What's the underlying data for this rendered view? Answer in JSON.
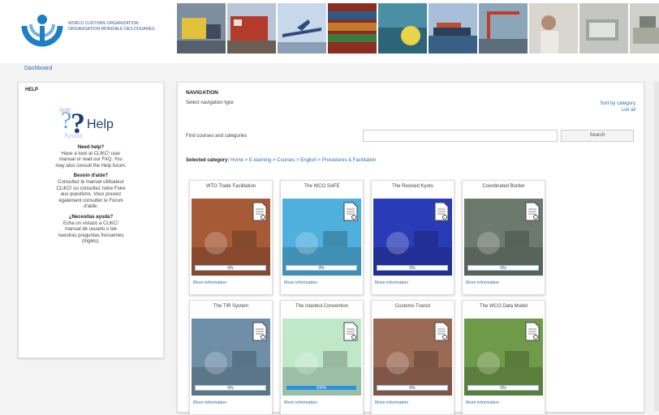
{
  "header": {
    "logo_text_line1": "WORLD CUSTOMS ORGANIZATION",
    "logo_text_line2": "ORGANISATION MONDIALE DES DOUANES",
    "banner_images": [
      "truck-photo",
      "train-photo",
      "airplane-photo",
      "containers-photo",
      "port-worker-photo",
      "cargo-ship-photo",
      "crane-photo",
      "inspector-photo",
      "office-photo",
      "desk-photo"
    ]
  },
  "dashboard_link": "Dashboard",
  "help": {
    "title": "HELP",
    "graphic_word": "Help",
    "sections": [
      {
        "heading": "Need help?",
        "text": "Have a look at CLIKC! user manual or read our FAQ. You may also consult the Help forum."
      },
      {
        "heading": "Besoin d'aide?",
        "text": "Consultez le manuel utilisateur CLiKC! ou consultez notre Foire aux questions. Vous pouvez également consulter le Forum d'aide."
      },
      {
        "heading": "¿Necesitas ayuda?",
        "text": "Echa un vistazo a CLiKC! manual de usuario o lee nuestras preguntas frecuentes (Inglés)."
      }
    ]
  },
  "navigation": {
    "title": "NAVIGATION",
    "subtitle": "Select navigation type",
    "sort_by_category": "Sort by category",
    "list_all": "List all",
    "find_label": "Find courses and categories",
    "search_value": "",
    "search_button": "Search",
    "breadcrumb_label": "Selected category:",
    "breadcrumb_path": "Home > E-learning > Courses > English > Procedures & Facilitation",
    "courses": [
      {
        "title": "WTO Trade Facilitation",
        "progress": "0%",
        "more": "More information",
        "image": "truck-in-fog",
        "color": "#a65a36"
      },
      {
        "title": "The WCO SAFE",
        "progress": "0%",
        "more": "More information",
        "image": "airplane-over-ship",
        "color": "#4fb0de"
      },
      {
        "title": "The Revised Kyoto",
        "progress": "0%",
        "more": "More information",
        "image": "blue-grid-cubes",
        "color": "#2a3bb8"
      },
      {
        "title": "Coordinated Border",
        "progress": "0%",
        "more": "More information",
        "image": "border-crowd",
        "color": "#6c7a6e"
      },
      {
        "title": "The TIR System",
        "progress": "0%",
        "more": "More information",
        "image": "trucks-at-border",
        "color": "#6f8fa8"
      },
      {
        "title": "The Istanbul Convention",
        "progress": "100%",
        "more": "More information",
        "image": "carnet-document",
        "color": "#bfe8c9"
      },
      {
        "title": "Customs Transit",
        "progress": "0%",
        "more": "More information",
        "image": "truck-convoy",
        "color": "#9b6a55"
      },
      {
        "title": "The WCO Data Model",
        "progress": "0%",
        "more": "More information",
        "image": "dirt-road-hills",
        "color": "#6f9a4a"
      }
    ]
  }
}
